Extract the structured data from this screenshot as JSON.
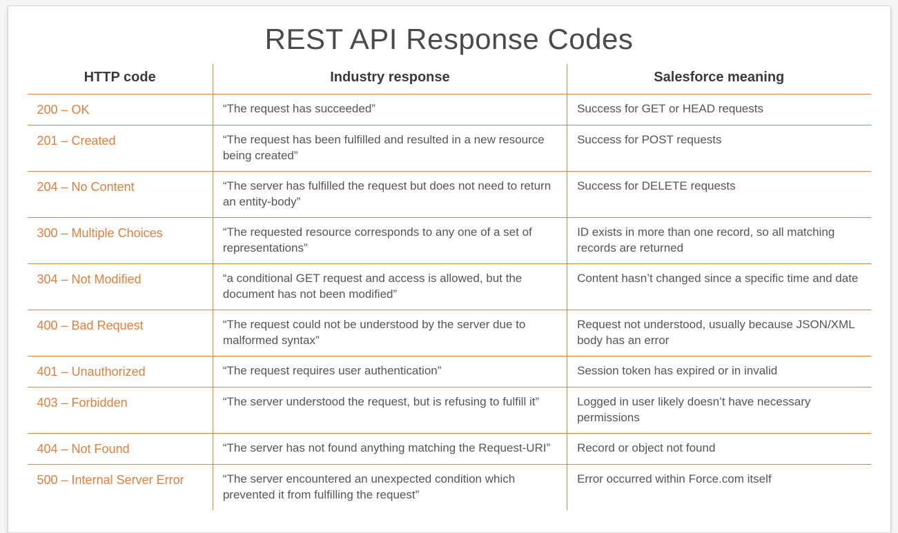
{
  "title": "REST API Response Codes",
  "headers": {
    "code": "HTTP code",
    "industry": "Industry response",
    "salesforce": "Salesforce meaning"
  },
  "rows": [
    {
      "code": "200 – OK",
      "industry": "“The request has succeeded”",
      "salesforce": "Success for GET or HEAD requests"
    },
    {
      "code": "201 – Created",
      "industry": "“The request has been fulfilled and resulted in a new resource being created”",
      "salesforce": "Success for POST requests"
    },
    {
      "code": "204 – No Content",
      "industry": "“The server has fulfilled the request but does not need to return an entity-body”",
      "salesforce": "Success for DELETE requests"
    },
    {
      "code": "300 – Multiple Choices",
      "industry": "“The requested resource corresponds to any one of a set of representations”",
      "salesforce": "ID exists in more than one record, so all matching records are returned"
    },
    {
      "code": "304 – Not Modified",
      "industry": "“a conditional GET request and access is allowed, but the document has not been modified”",
      "salesforce": "Content hasn’t changed since a specific time and date"
    },
    {
      "code": "400 – Bad Request",
      "industry": "“The request could not be understood by the server due to malformed syntax”",
      "salesforce": "Request not understood, usually because JSON/XML body has an error"
    },
    {
      "code": "401 – Unauthorized",
      "industry": "“The request requires user authentication”",
      "salesforce": "Session token has expired or in invalid"
    },
    {
      "code": "403 – Forbidden",
      "industry": "“The server understood the request, but is refusing to fulfill it”",
      "salesforce": "Logged in user likely doesn’t have necessary permissions"
    },
    {
      "code": "404 – Not Found",
      "industry": "“The server has not found anything matching the Request-URI”",
      "salesforce": "Record or object not found"
    },
    {
      "code": "500 – Internal Server Error",
      "industry": "“The server encountered an unexpected condition which prevented it from fulfilling the request”",
      "salesforce": "Error occurred within Force.com itself"
    }
  ]
}
